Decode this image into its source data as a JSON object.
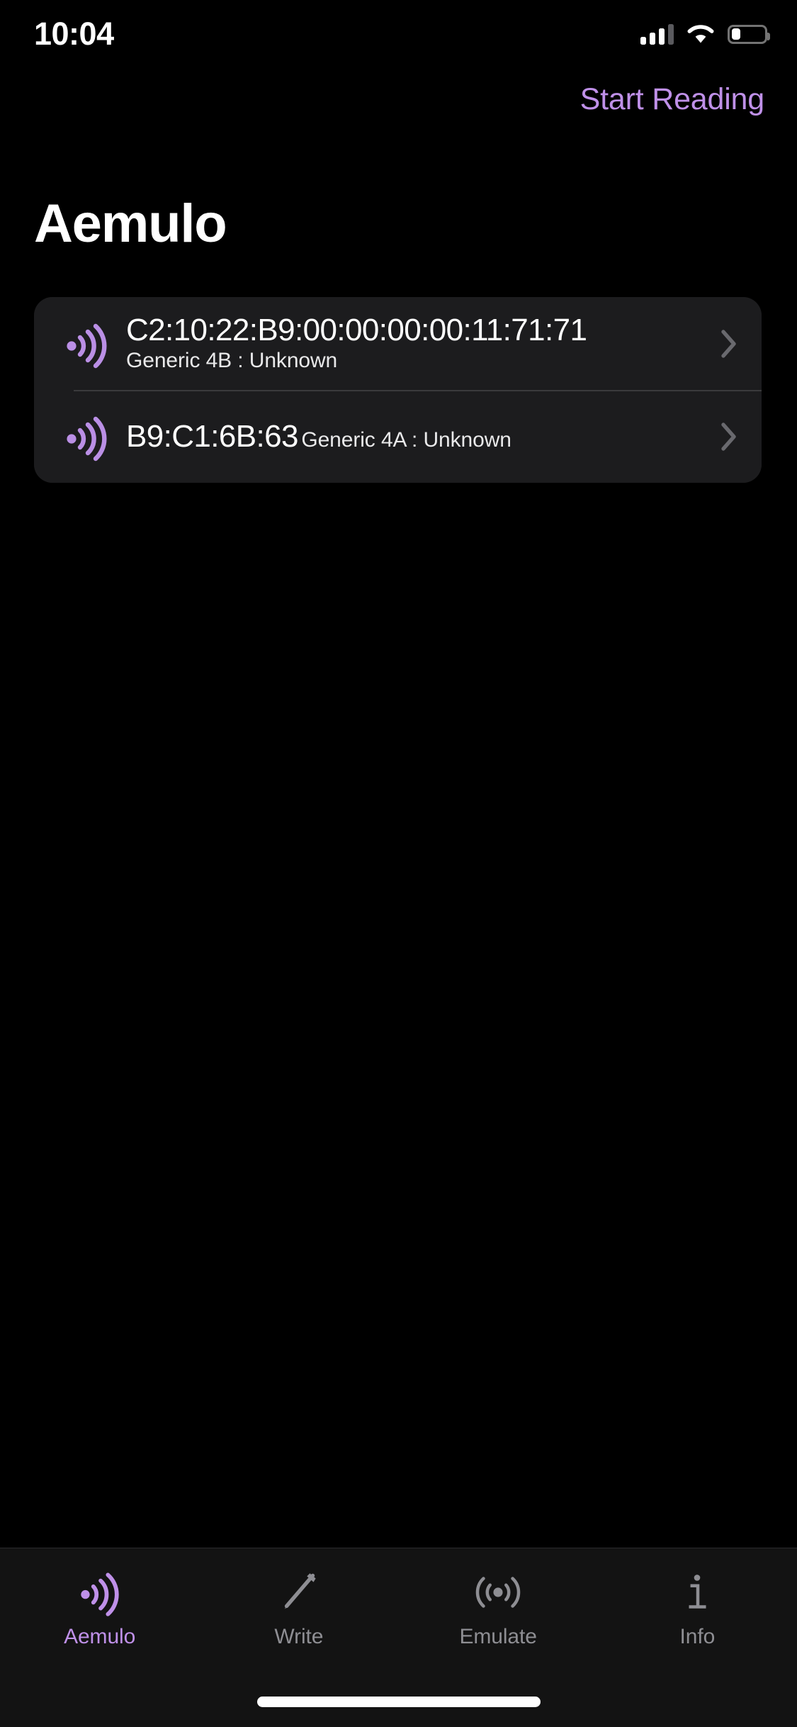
{
  "status_bar": {
    "time": "10:04",
    "cellular_icon": "cellular-signal-icon",
    "cellular_bars_filled": 3,
    "cellular_bars_total": 4,
    "wifi_icon": "wifi-icon",
    "battery_icon": "battery-icon",
    "battery_level_percent": 28
  },
  "nav": {
    "start_reading_label": "Start Reading"
  },
  "header": {
    "title": "Aemulo"
  },
  "tag_list": {
    "rows": [
      {
        "icon": "nfc-wave-icon",
        "title": "C2:10:22:B9:00:00:00:00:11:71:71",
        "subtitle": "Generic 4B : Unknown",
        "chevron": "chevron-right-icon"
      },
      {
        "icon": "nfc-wave-icon",
        "title": "B9:C1:6B:63",
        "subtitle": "Generic 4A : Unknown",
        "chevron": "chevron-right-icon"
      }
    ]
  },
  "tab_bar": {
    "items": [
      {
        "label": "Aemulo",
        "icon": "nfc-wave-icon",
        "active": true
      },
      {
        "label": "Write",
        "icon": "pencil-icon",
        "active": false
      },
      {
        "label": "Emulate",
        "icon": "radio-waves-icon",
        "active": false
      },
      {
        "label": "Info",
        "icon": "info-icon",
        "active": false
      }
    ]
  },
  "colors": {
    "background": "#000000",
    "card_background": "#1C1C1E",
    "accent_purple": "#BF90E8",
    "primary_text": "#FFFFFF",
    "secondary_text": "#8E8E93",
    "separator": "#3A3A3C",
    "tab_bar_background": "#131313"
  }
}
